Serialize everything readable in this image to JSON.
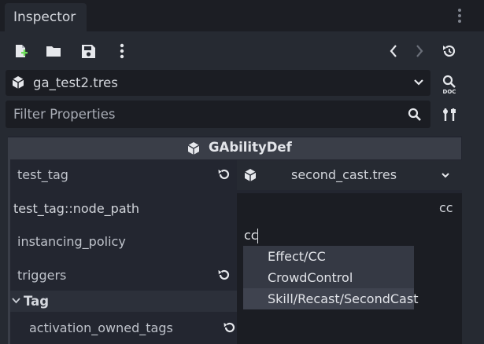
{
  "tab": {
    "title": "Inspector"
  },
  "toolbar": {
    "icons": [
      "new-resource-icon",
      "open-folder-icon",
      "save-icon",
      "more-options-icon",
      "back-icon",
      "forward-icon",
      "history-icon"
    ]
  },
  "resource": {
    "name": "ga_test2.tres"
  },
  "filter": {
    "placeholder": "Filter Properties"
  },
  "object_header": {
    "title": "GAbilityDef"
  },
  "properties": {
    "test_tag": {
      "label": "test_tag",
      "value": "second_cast.tres"
    },
    "node_path": {
      "label": "test_tag::node_path",
      "value": "cc"
    },
    "instancing_policy": {
      "label": "instancing_policy",
      "value": "cc"
    },
    "triggers": {
      "label": "triggers"
    },
    "tag_section": {
      "label": "Tag"
    },
    "activation_owned_tags": {
      "label": "activation_owned_tags"
    }
  },
  "autocomplete": {
    "items": [
      "Effect/CC",
      "CrowdControl",
      "Skill/Recast/SecondCast"
    ]
  },
  "colors": {
    "background": "#262a32",
    "field": "#1b1d23",
    "header": "#3a3e48",
    "popup_item": "#353944"
  }
}
